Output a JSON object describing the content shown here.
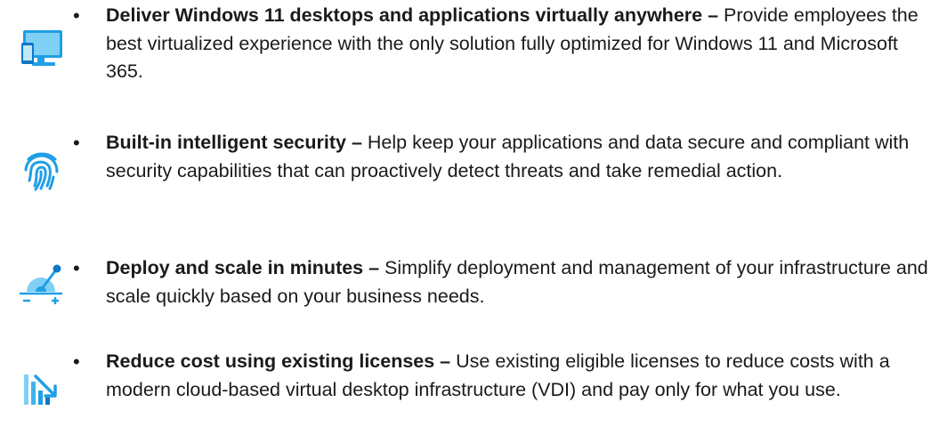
{
  "features": [
    {
      "icon": "desktop-devices-icon",
      "title": "Deliver Windows 11 desktops and applications virtually anywhere –",
      "body": " Provide employees the best virtualized experience with the only solution fully optimized for Windows 11 and Microsoft 365."
    },
    {
      "icon": "fingerprint-icon",
      "title": "Built-in intelligent security –",
      "body": " Help keep your applications and data secure and compliant with security capabilities that can proactively detect threats and take remedial action."
    },
    {
      "icon": "scale-gauge-icon",
      "title": "Deploy and scale in minutes –",
      "body": " Simplify deployment and management of your infrastructure and scale quickly based on your business needs."
    },
    {
      "icon": "cost-reduction-chart-icon",
      "title": "Reduce cost using existing licenses –",
      "body": " Use existing eligible licenses to reduce costs with a modern cloud-based virtual desktop infrastructure (VDI) and pay only for what you use."
    }
  ],
  "bullet_char": "•",
  "colors": {
    "icon_blue": "#1F9FE5",
    "icon_light": "#7FD0F5",
    "text": "#1a1a1a"
  }
}
